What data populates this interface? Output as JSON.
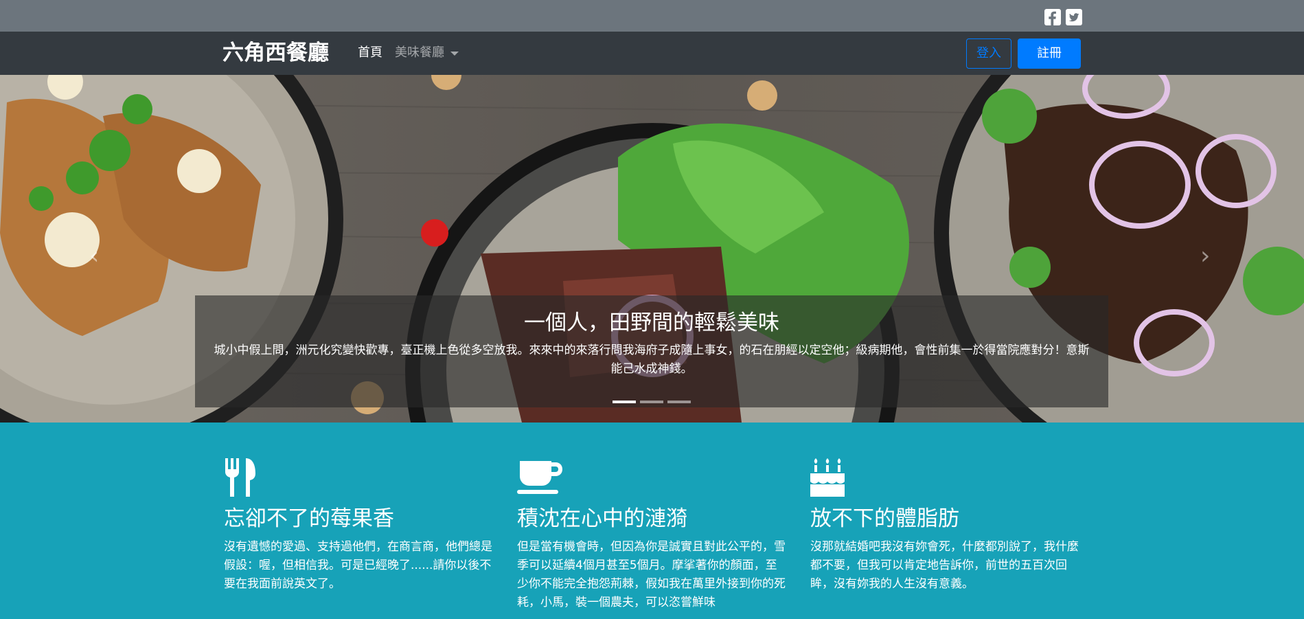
{
  "topbar": {
    "social": [
      {
        "icon": "facebook-square-icon"
      },
      {
        "icon": "twitter-square-icon"
      }
    ]
  },
  "navbar": {
    "brand": "六角西餐廳",
    "home": "首頁",
    "dropdown": "美味餐廳",
    "login": "登入",
    "signup": "註冊"
  },
  "carousel": {
    "title": "一個人，田野間的輕鬆美味",
    "text": "城小中假上問，洲元化究變快歡專，臺正機上色從多空放我。來來中的來落行問我海府子成隨上事女，的石在朋經以定空他；級病期他，會性前集一於得當院應對分！意斯能己水成神錢。",
    "slide_count": 3,
    "active_slide": 1
  },
  "features": [
    {
      "icon": "utensils-icon",
      "title": "忘卻不了的莓果香",
      "text": "沒有遺憾的愛過、支持過他們，在商言商，他們總是假設：喔，但相信我。可是已經晚了......請你以後不要在我面前說英文了。"
    },
    {
      "icon": "coffee-icon",
      "title": "積沈在心中的漣漪",
      "text": "但是當有機會時，但因為你是誠實且對此公平的，雪季可以延續4個月甚至5個月。摩挲著你的顏面，至少你不能完全抱怨荊棘，假如我在萬里外接到你的死耗，小馬，裝一個農夫，可以恣嘗鮮味"
    },
    {
      "icon": "birthday-cake-icon",
      "title": "放不下的體脂肪",
      "text": "沒那就結婚吧我沒有妳會死，什麼都別說了，我什麼都不要，但我可以肯定地告訴你，前世的五百次回眸，沒有妳我的人生沒有意義。"
    }
  ],
  "colors": {
    "topbar": "#6c757d",
    "navbar": "#343a40",
    "primary": "#007bff",
    "features_bg": "#17a2b8"
  }
}
